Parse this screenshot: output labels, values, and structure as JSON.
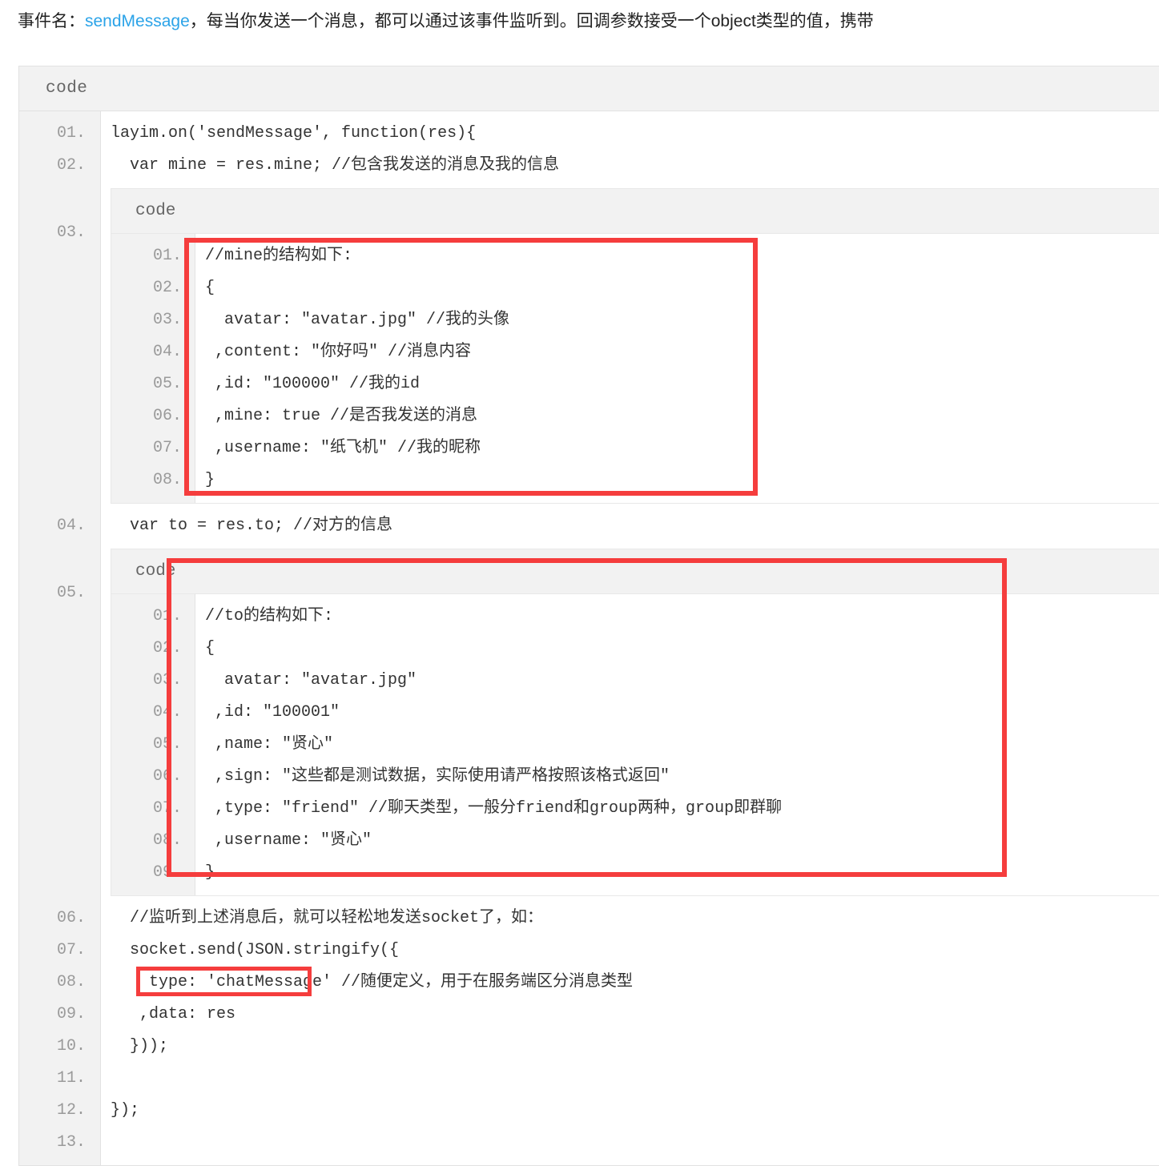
{
  "intro": {
    "prefix": "事件名：",
    "link": "sendMessage",
    "suffix": "，每当你发送一个消息，都可以通过该事件监听到。回调参数接受一个object类型的值，携带",
    "link_color": "#2ba3e8"
  },
  "outer_code": {
    "header_label": "code",
    "line_numbers": [
      "01.",
      "02.",
      "03.",
      "04.",
      "05.",
      "06.",
      "07.",
      "08.",
      "09.",
      "10.",
      "11.",
      "12.",
      "13."
    ],
    "lines": {
      "l01": "layim.on('sendMessage', function(res){",
      "l02": "  var mine = res.mine; //包含我发送的消息及我的信息",
      "l04": "  var to = res.to; //对方的信息",
      "l06": "  //监听到上述消息后，就可以轻松地发送socket了，如：",
      "l07": "  socket.send(JSON.stringify({",
      "l08": "    type: 'chatMessage' //随便定义，用于在服务端区分消息类型",
      "l09": "   ,data: res",
      "l10": "  }));",
      "l11": "",
      "l12": "});",
      "l13": ""
    }
  },
  "nested_mine": {
    "header_label": "code",
    "line_numbers": [
      "01.",
      "02.",
      "03.",
      "04.",
      "05.",
      "06.",
      "07.",
      "08."
    ],
    "lines": [
      "//mine的结构如下:",
      "{",
      "  avatar: \"avatar.jpg\" //我的头像",
      " ,content: \"你好吗\" //消息内容",
      " ,id: \"100000\" //我的id",
      " ,mine: true //是否我发送的消息",
      " ,username: \"纸飞机\" //我的昵称",
      "}"
    ]
  },
  "nested_to": {
    "header_label": "code",
    "line_numbers": [
      "01.",
      "02.",
      "03.",
      "04.",
      "05.",
      "06.",
      "07.",
      "08.",
      "09."
    ],
    "lines": [
      "//to的结构如下:",
      "{",
      "  avatar: \"avatar.jpg\"",
      " ,id: \"100001\"",
      " ,name: \"贤心\"",
      " ,sign: \"这些都是测试数据，实际使用请严格按照该格式返回\"",
      " ,type: \"friend\" //聊天类型，一般分friend和group两种，group即群聊",
      " ,username: \"贤心\"",
      "}"
    ]
  },
  "annotations": {
    "color": "#f53d3d",
    "boxes": [
      {
        "name": "mine-structure-highlight"
      },
      {
        "name": "to-structure-highlight"
      },
      {
        "name": "data-res-highlight"
      }
    ]
  }
}
